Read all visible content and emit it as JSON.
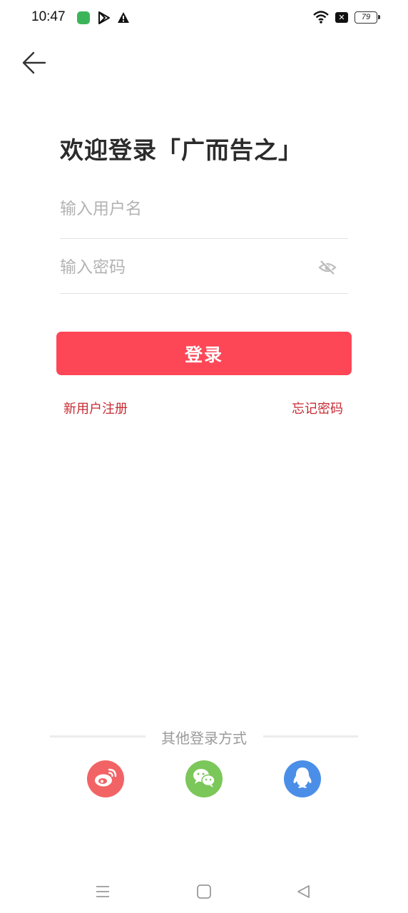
{
  "status_bar": {
    "time": "10:47",
    "battery": "79",
    "icons": [
      "app-icon",
      "play-store-icon",
      "warning-icon",
      "wifi-icon",
      "close-box-icon",
      "battery-icon"
    ]
  },
  "header": {
    "back_icon": "arrow-left-icon",
    "title": "欢迎登录「广而告之」"
  },
  "form": {
    "username_placeholder": "输入用户名",
    "username_value": "",
    "password_placeholder": "输入密码",
    "password_value": "",
    "password_toggle_icon": "eye-off-icon",
    "login_label": "登录"
  },
  "links": {
    "register": "新用户注册",
    "forgot": "忘记密码"
  },
  "other_login": {
    "label": "其他登录方式",
    "providers": [
      {
        "name": "weibo-icon",
        "color": "#f26365"
      },
      {
        "name": "wechat-icon",
        "color": "#7bc75a"
      },
      {
        "name": "qq-icon",
        "color": "#4b8ee8"
      }
    ]
  },
  "colors": {
    "accent": "#fd4757",
    "link": "#c62b33"
  },
  "nav_bar": {
    "icons": [
      "menu-icon",
      "home-icon",
      "back-triangle-icon"
    ]
  }
}
